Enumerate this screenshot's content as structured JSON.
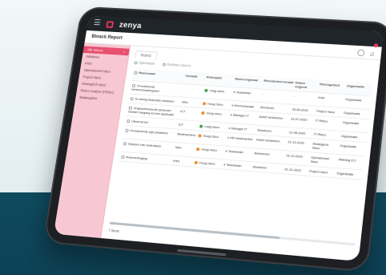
{
  "app": {
    "logo_text": "zenya"
  },
  "header": {
    "breadcrumb": "Bloack Report"
  },
  "sidebar": {
    "close_glyph": "×",
    "items": [
      {
        "label": "Alle risico's",
        "active": true
      },
      {
        "label": "Initiatives",
        "active": false
      },
      {
        "label": "Kriat",
        "active": false
      },
      {
        "label": "Operationeel risico",
        "active": false
      },
      {
        "label": "Project risico",
        "active": false
      },
      {
        "label": "Strategisch risico",
        "active": false
      },
      {
        "label": "Risico Analyse (PRISA)",
        "active": false
      },
      {
        "label": "Maatregelen",
        "active": false
      }
    ]
  },
  "main": {
    "tab_label": "RISKS",
    "filters": [
      "Openstaan",
      "Gesloten risico's"
    ],
    "table": {
      "columns": [
        "Risiconaam",
        "Oorzaak",
        "Risicopiek",
        "Risico-eigenaar",
        "Risicobeheersmaatregelen",
        "Datum volgend",
        "Risicogebied",
        "Organisatie"
      ],
      "rows": [
        [
          "Onvoldoende beheersmaatregelen",
          "-",
          "Laag risico",
          "Teamleider",
          "-",
          "-",
          "Kriet",
          "Organisatie"
        ],
        [
          "Te weinig financiële middelen",
          "Infra",
          "Hoog risico",
          "Eenmanszaak",
          "Monitoren",
          "25-08-2020",
          "Project risico",
          "Organisatie"
        ],
        [
          "Ongeautoriseerde personen hebben toegang tot een applicatie",
          "ICT",
          "Hoog risico",
          "Manager IT",
          "Actief verbeteren",
          "23-07-2020",
          "IT Risico",
          "Organisatie"
        ],
        [
          "Uitval server",
          "ICT",
          "Laag risico",
          "Manager IT",
          "Monitoren",
          "21-08-2020",
          "IT Risico",
          "Organisatie"
        ],
        [
          "Onvoldoende (opl.)middelen",
          "Medewerkers",
          "Hoog risico",
          "HR-medewerker",
          "Actief verbeteren",
          "21-12-2020",
          "Strategisch risico",
          "Organisatie"
        ],
        [
          "Stoppen van onderdelen",
          "Infra",
          "Hoog risico",
          "Teamleider",
          "Beheersen",
          "01-12-2020",
          "Operationeel risico",
          "Afdeling ICT"
        ],
        [
          "Bouwvertraging",
          "Infra",
          "Hoog risico",
          "Teamleider",
          "Monitoren",
          "01-12-2020",
          "Project risico",
          "Organisatie"
        ]
      ]
    },
    "record_count": "7 items"
  },
  "colors": {
    "accent": "#e5385a",
    "sidebar_bg": "#f7c8d3",
    "high_risk": "#f08a2c",
    "low_risk": "#3ca04a"
  },
  "icons": {
    "menu": "hamburger-icon",
    "user": "user-icon",
    "notifications": "bell-icon"
  }
}
